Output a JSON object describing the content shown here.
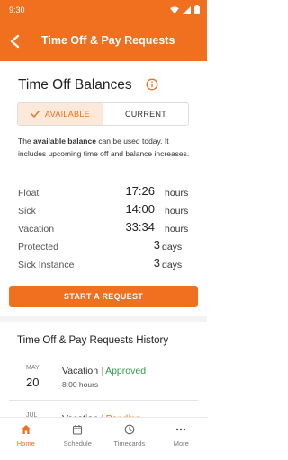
{
  "status_bar": {
    "time": "9:30"
  },
  "app_bar": {
    "title": "Time Off & Pay Requests"
  },
  "balances": {
    "title": "Time Off Balances",
    "toggle": {
      "available": "AVAILABLE",
      "current": "CURRENT",
      "selected": "AVAILABLE"
    },
    "description": {
      "prefix": "The ",
      "bold": "available balance",
      "suffix": " can be used today. It includes upcoming time off and balance increases."
    },
    "rows": [
      {
        "label": "Float",
        "value": "17:26",
        "unit": "hours"
      },
      {
        "label": "Sick",
        "value": "14:00",
        "unit": "hours"
      },
      {
        "label": "Vacation",
        "value": "33:34",
        "unit": "hours"
      },
      {
        "label": "Protected",
        "value": "3",
        "unit": "days"
      },
      {
        "label": "Sick Instance",
        "value": "3",
        "unit": "days"
      }
    ],
    "start_button": "START A REQUEST"
  },
  "history": {
    "title": "Time Off & Pay Requests History",
    "items": [
      {
        "month": "MAY",
        "day": "20",
        "type": "Vacation",
        "separator": "|",
        "status": "Approved",
        "hours": "8:00 hours"
      },
      {
        "month": "JUL",
        "day": "",
        "type": "Vacation",
        "separator": "|",
        "status": "Pending",
        "hours": ""
      }
    ]
  },
  "bottom_nav": {
    "tabs": [
      {
        "label": "Home",
        "icon": "home-icon",
        "active": true
      },
      {
        "label": "Schedule",
        "icon": "schedule-icon",
        "active": false
      },
      {
        "label": "Timecards",
        "icon": "clock-icon",
        "active": false
      },
      {
        "label": "More",
        "icon": "more-icon",
        "active": false
      }
    ]
  },
  "colors": {
    "accent": "#f0701f",
    "approved": "#2e9a4a",
    "pending": "#f0701f"
  }
}
